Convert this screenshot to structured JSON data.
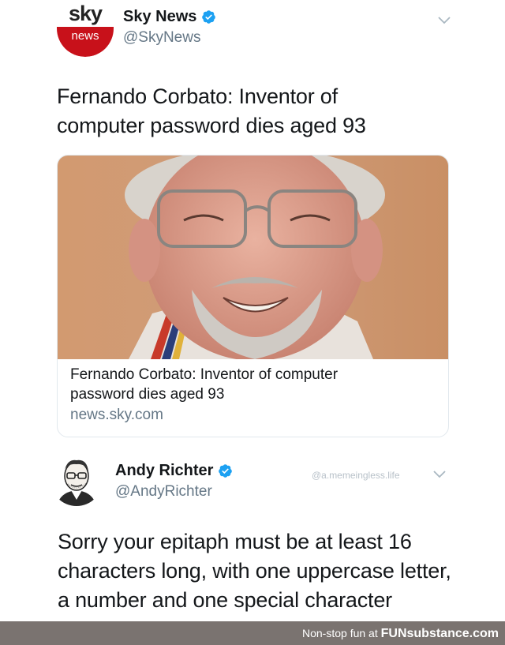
{
  "tweets": [
    {
      "display_name": "Sky News",
      "handle": "@SkyNews",
      "verified": true,
      "avatar": {
        "logo_top": "sky",
        "logo_bottom": "news"
      },
      "text_lines": [
        "Fernando Corbato: Inventor of",
        "computer password dies aged 93"
      ],
      "card": {
        "title_lines": [
          "Fernando Corbato: Inventor of computer",
          "password dies aged 93"
        ],
        "domain": "news.sky.com",
        "image_alt": "photo-of-smiling-man-with-glasses"
      }
    },
    {
      "display_name": "Andy Richter",
      "handle": "@AndyRichter",
      "verified": true,
      "watermark": "@a.memeingless.life",
      "text_lines": [
        "Sorry your epitaph must be at least 16",
        "characters long, with one uppercase letter,",
        "a number and one special character"
      ]
    }
  ],
  "footer": {
    "prefix": "Non-stop fun at",
    "brand": "FUNsubstance.com"
  },
  "colors": {
    "verified": "#1da1f2",
    "sky_red": "#c8111a",
    "handle_gray": "#657786",
    "footer_bg": "#7a7370"
  },
  "icons": [
    "verified-badge-icon",
    "chevron-down-icon"
  ]
}
